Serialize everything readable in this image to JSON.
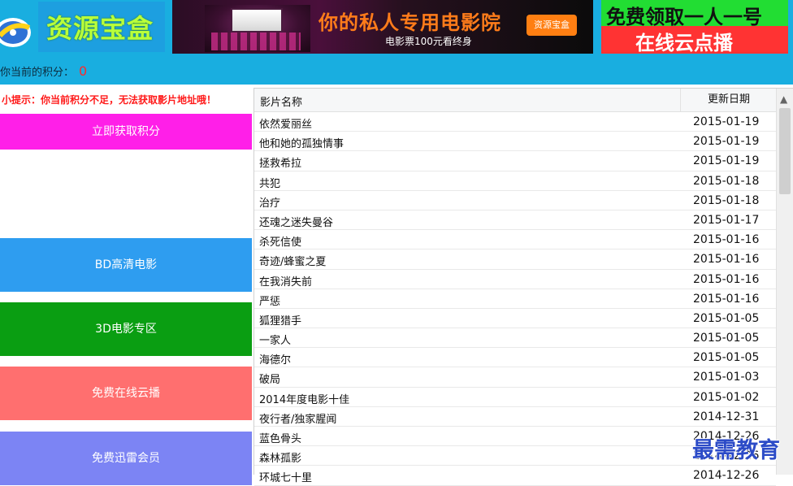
{
  "header": {
    "logo_text": "资源宝盒",
    "banner_left": {
      "title": "你的私人专用电影院",
      "subtitle": "电影票100元看终身",
      "button": "资源宝盒"
    },
    "banner_right": {
      "line1": "免费领取一人一号",
      "line2": "在线云点播"
    },
    "score": {
      "label": "你当前的积分：",
      "value": "0"
    }
  },
  "sidebar": {
    "tip": "小提示：你当前积分不足，无法获取影片地址哦！",
    "buttons": {
      "get_points": "立即获取积分",
      "bd": "BD高清电影",
      "d3": "3D电影专区",
      "cloud": "免费在线云播",
      "xunlei": "免费迅雷会员"
    }
  },
  "table": {
    "headers": {
      "name": "影片名称",
      "date": "更新日期"
    },
    "rows": [
      {
        "name": "依然爱丽丝",
        "date": "2015-01-19"
      },
      {
        "name": "他和她的孤独情事",
        "date": "2015-01-19"
      },
      {
        "name": "拯救希拉",
        "date": "2015-01-19"
      },
      {
        "name": "共犯",
        "date": "2015-01-18"
      },
      {
        "name": "治疗",
        "date": "2015-01-18"
      },
      {
        "name": "还魂之迷失曼谷",
        "date": "2015-01-17"
      },
      {
        "name": "杀死信使",
        "date": "2015-01-16"
      },
      {
        "name": "奇迹/蜂蜜之夏",
        "date": "2015-01-16"
      },
      {
        "name": "在我消失前",
        "date": "2015-01-16"
      },
      {
        "name": "严惩",
        "date": "2015-01-16"
      },
      {
        "name": "狐狸猎手",
        "date": "2015-01-05"
      },
      {
        "name": "一家人",
        "date": "2015-01-05"
      },
      {
        "name": "海德尔",
        "date": "2015-01-05"
      },
      {
        "name": "破局",
        "date": "2015-01-03"
      },
      {
        "name": "2014年度电影十佳",
        "date": "2015-01-02"
      },
      {
        "name": "夜行者/独家腥闻",
        "date": "2014-12-31"
      },
      {
        "name": "蓝色骨头",
        "date": "2014-12-26"
      },
      {
        "name": "森林孤影",
        "date": "2014-12-26"
      },
      {
        "name": "环城七十里",
        "date": "2014-12-26"
      }
    ]
  },
  "watermark": "最需教育",
  "icons": {
    "logo": "logo-icon",
    "scroll_up": "chevron-up-icon"
  }
}
